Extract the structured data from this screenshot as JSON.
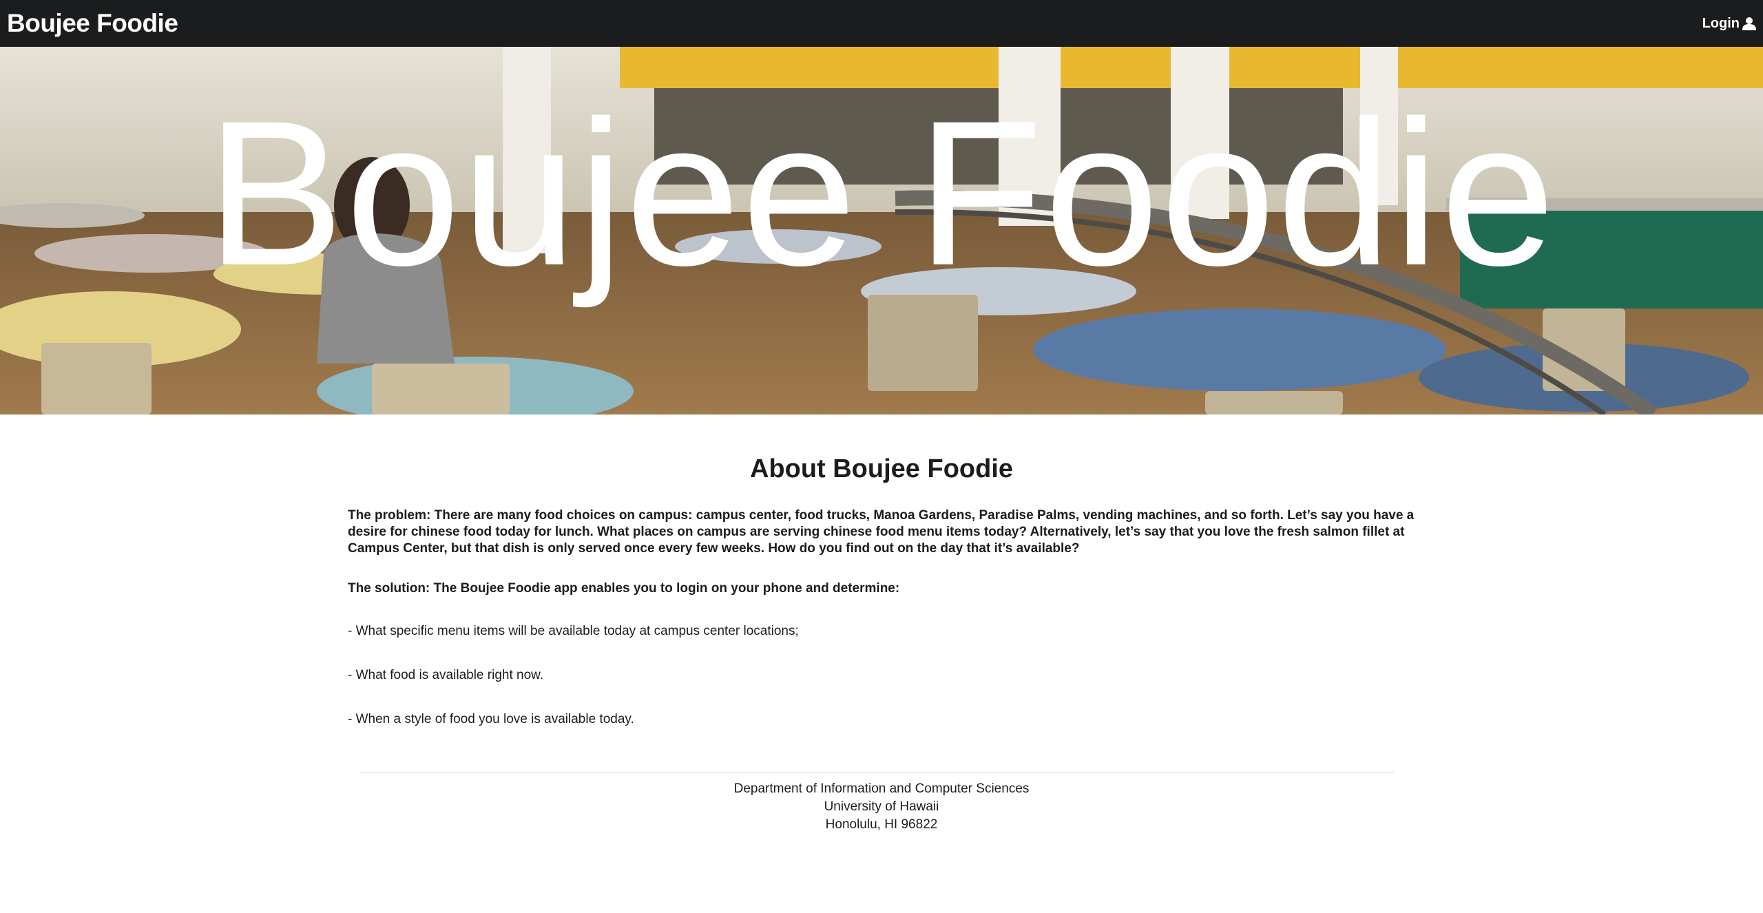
{
  "navbar": {
    "brand": "Boujee Foodie",
    "login_label": "Login",
    "login_icon": "user-icon"
  },
  "hero": {
    "title": "Boujee Foodie"
  },
  "about": {
    "heading": "About Boujee Foodie",
    "problem": "The problem: There are many food choices on campus: campus center, food trucks, Manoa Gardens, Paradise Palms, vending machines, and so forth. Let’s say you have a desire for chinese food today for lunch. What places on campus are serving chinese food menu items today? Alternatively, let’s say that you love the fresh salmon fillet at Campus Center, but that dish is only served once every few weeks. How do you find out on the day that it’s available?",
    "solution": "The solution: The Boujee Foodie app enables you to login on your phone and determine:",
    "bullets": [
      "- What specific menu items will be available today at campus center locations;",
      "- What food is available right now.",
      "- When a style of food you love is available today."
    ]
  },
  "footer": {
    "line1": "Department of Information and Computer Sciences",
    "line2": "University of Hawaii",
    "line3": "Honolulu, HI 96822"
  },
  "colors": {
    "navbar_bg": "#1b1c1d",
    "text": "#1b1c1d",
    "hero_text": "#ffffff"
  }
}
